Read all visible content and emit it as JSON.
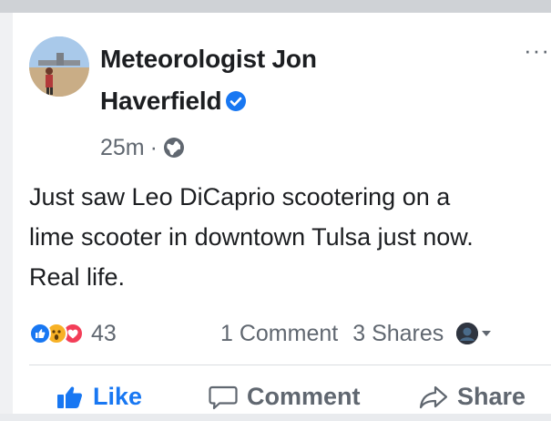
{
  "post": {
    "author": "Meteorologist Jon Haverfield",
    "author_line1": "Meteorologist Jon",
    "author_line2": "Haverfield",
    "time": "25m",
    "dot": "·",
    "text": "Just saw Leo DiCaprio scootering on a lime scooter in downtown Tulsa just now. Real life.",
    "text_lines": [
      "Just saw Leo DiCaprio scootering on a",
      "lime scooter in downtown Tulsa just now.",
      "Real life."
    ],
    "more": "···",
    "reactions_count": "43",
    "comments": "1 Comment",
    "shares": "3 Shares",
    "actions": {
      "like": "Like",
      "comment": "Comment",
      "share": "Share"
    },
    "icons": {
      "verified": "verified-badge-icon",
      "privacy": "globe-icon",
      "reactions": [
        "like-reaction-icon",
        "wow-reaction-icon",
        "love-reaction-icon"
      ],
      "viewer": "viewer-avatar",
      "like": "thumbs-up-icon",
      "comment": "speech-bubble-icon",
      "share": "share-arrow-icon"
    },
    "colors": {
      "accent": "#1877f2",
      "secondary_text": "#606770",
      "love": "#f33e58",
      "wow": "#f7b125"
    }
  }
}
